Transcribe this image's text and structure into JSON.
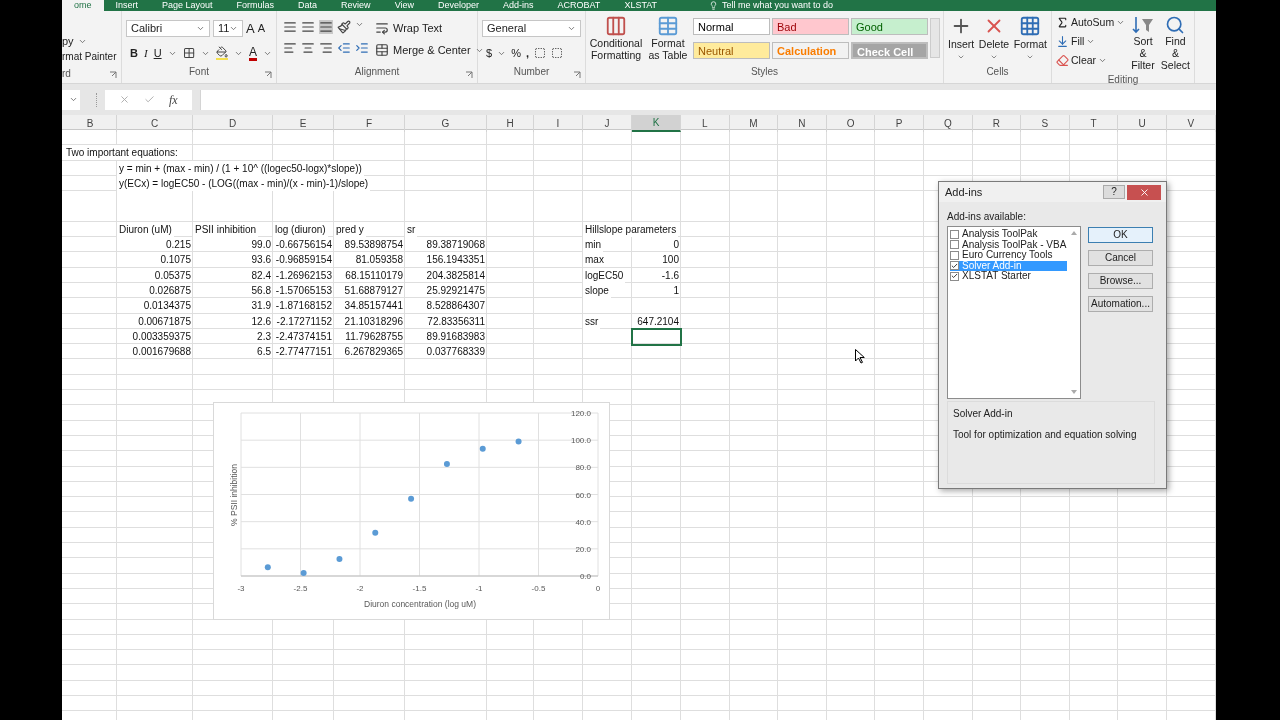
{
  "ribbon_tabs": [
    {
      "label": "ome",
      "selected": true
    },
    {
      "label": "Insert",
      "selected": false
    },
    {
      "label": "Page Layout",
      "selected": false
    },
    {
      "label": "Formulas",
      "selected": false
    },
    {
      "label": "Data",
      "selected": false
    },
    {
      "label": "Review",
      "selected": false
    },
    {
      "label": "View",
      "selected": false
    },
    {
      "label": "Developer",
      "selected": false
    },
    {
      "label": "Add-ins",
      "selected": false
    },
    {
      "label": "ACROBAT",
      "selected": false
    },
    {
      "label": "XLSTAT",
      "selected": false
    }
  ],
  "tell_me": "Tell me what you want to do",
  "ribbon": {
    "clipboard": {
      "copy": "py",
      "painter": "rmat Painter",
      "label": "rd"
    },
    "font": {
      "name": "Calibri",
      "size": "11",
      "bold": "B",
      "italic": "I",
      "underline": "U",
      "grow": "A",
      "shrink": "A",
      "color_letter": "A",
      "label": "Font"
    },
    "alignment": {
      "wrap": "Wrap Text",
      "merge": "Merge & Center",
      "label": "Alignment"
    },
    "number": {
      "format": "General",
      "currency": "$",
      "percent": "%",
      "comma": ",",
      "label": "Number"
    },
    "styles": {
      "conditional": "Conditional Formatting",
      "table": "Format as Table",
      "label": "Styles",
      "cell_styles": [
        {
          "label": "Normal",
          "color": "#ffffff",
          "kind": "normal"
        },
        {
          "label": "Bad",
          "color": "#ffc7ce",
          "kind": "bad"
        },
        {
          "label": "Good",
          "color": "#c6efce",
          "kind": "good"
        },
        {
          "label": "Neutral",
          "color": "#ffeb9c",
          "kind": "neutral"
        },
        {
          "label": "Calculation",
          "color": "#f2f2f2",
          "kind": "calculation"
        },
        {
          "label": "Check Cell",
          "color": "#a5a5a5",
          "kind": "check"
        }
      ]
    },
    "cells": {
      "buttons": [
        "Insert",
        "Delete",
        "Format"
      ],
      "label": "Cells"
    },
    "editing": {
      "autosum": "AutoSum",
      "fill": "Fill",
      "clear": "Clear",
      "sort": "Sort & Filter",
      "find": "Find & Select",
      "label": "Editing"
    }
  },
  "formula_bar": {
    "fx": "fx"
  },
  "sheet": {
    "columns": [
      {
        "label": "B",
        "selected": false
      },
      {
        "label": "C",
        "selected": false
      },
      {
        "label": "D",
        "selected": false
      },
      {
        "label": "E",
        "selected": false
      },
      {
        "label": "F",
        "selected": false
      },
      {
        "label": "G",
        "selected": false
      },
      {
        "label": "H",
        "selected": false
      },
      {
        "label": "I",
        "selected": false
      },
      {
        "label": "J",
        "selected": false
      },
      {
        "label": "K",
        "selected": true
      },
      {
        "label": "L",
        "selected": false
      },
      {
        "label": "M",
        "selected": false
      },
      {
        "label": "N",
        "selected": false
      },
      {
        "label": "O",
        "selected": false
      },
      {
        "label": "P",
        "selected": false
      },
      {
        "label": "Q",
        "selected": false
      },
      {
        "label": "R",
        "selected": false
      },
      {
        "label": "S",
        "selected": false
      },
      {
        "label": "T",
        "selected": false
      },
      {
        "label": "U",
        "selected": false
      },
      {
        "label": "V",
        "selected": false
      }
    ],
    "equations": {
      "title": "Two important equations:",
      "lines": [
        "y = min + (max - min) / (1 + 10^ ((logec50-logx)*slope))",
        "y(ECx) = logEC50 - (LOG((max - min)/(x - min)-1)/slope)"
      ]
    },
    "data_table": {
      "headers": [
        "Diuron (uM)",
        "PSII inhibition",
        "log (diuron)",
        "pred y",
        "sr"
      ],
      "rows": [
        [
          "0.215",
          "99.0",
          "-0.66756154",
          "89.53898754",
          "89.38719068"
        ],
        [
          "0.1075",
          "93.6",
          "-0.96859154",
          "81.059358",
          "156.1943351"
        ],
        [
          "0.05375",
          "82.4",
          "-1.26962153",
          "68.15110179",
          "204.3825814"
        ],
        [
          "0.026875",
          "56.8",
          "-1.57065153",
          "51.68879127",
          "25.92921475"
        ],
        [
          "0.0134375",
          "31.9",
          "-1.87168152",
          "34.85157441",
          "8.528864307"
        ],
        [
          "0.00671875",
          "12.6",
          "-2.17271152",
          "21.10318296",
          "72.83356311"
        ],
        [
          "0.003359375",
          "2.3",
          "-2.47374151",
          "11.79628755",
          "89.91683983"
        ],
        [
          "0.001679688",
          "6.5",
          "-2.77477151",
          "6.267829365",
          "0.037768339"
        ]
      ]
    },
    "parameters": {
      "title": "Hillslope parameters",
      "rows": [
        {
          "name": "min",
          "value": "0"
        },
        {
          "name": "max",
          "value": "100"
        },
        {
          "name": "logEC50",
          "value": "-1.6"
        },
        {
          "name": "slope",
          "value": "1"
        }
      ]
    },
    "ssr": {
      "name": "ssr",
      "value": "647.2104"
    },
    "chart_data": {
      "type": "scatter",
      "grid": true,
      "xlabel": "Diuron concentration (log uM)",
      "ylabel": "% PSII inhibition",
      "x": [
        -0.66756154,
        -0.96859154,
        -1.26962153,
        -1.57065153,
        -1.87168152,
        -2.17271152,
        -2.47374151,
        -2.77477151
      ],
      "series": [
        {
          "color": "#5b9bd5",
          "values": [
            99.0,
            93.6,
            82.4,
            56.8,
            31.9,
            12.6,
            2.3,
            6.5
          ]
        }
      ],
      "xlim": [
        -3,
        0
      ],
      "ylim": [
        0,
        120
      ],
      "xticks": [
        -3,
        -2.5,
        -2,
        -1.5,
        -1,
        -0.5,
        0
      ],
      "yticks": [
        {
          "value": 0,
          "label": "0.0"
        },
        {
          "value": 20,
          "label": "20.0"
        },
        {
          "value": 40,
          "label": "40.0"
        },
        {
          "value": 60,
          "label": "60.0"
        },
        {
          "value": 80,
          "label": "80.0"
        },
        {
          "value": 100,
          "label": "100.0"
        },
        {
          "value": 120,
          "label": "120.0"
        }
      ]
    }
  },
  "dialog": {
    "title": "Add-ins",
    "help": "?",
    "list_label": "Add-ins available:",
    "items": [
      {
        "label": "Analysis ToolPak",
        "checked": false,
        "selected": false
      },
      {
        "label": "Analysis ToolPak - VBA",
        "checked": false,
        "selected": false
      },
      {
        "label": "Euro Currency Tools",
        "checked": false,
        "selected": false
      },
      {
        "label": "Solver Add-in",
        "checked": true,
        "selected": true
      },
      {
        "label": "XLSTAT Starter",
        "checked": true,
        "selected": false
      }
    ],
    "buttons": [
      "OK",
      "Cancel",
      "Browse...",
      "Automation..."
    ],
    "description": {
      "title": "Solver Add-in",
      "text": "Tool for optimization and equation solving"
    }
  }
}
